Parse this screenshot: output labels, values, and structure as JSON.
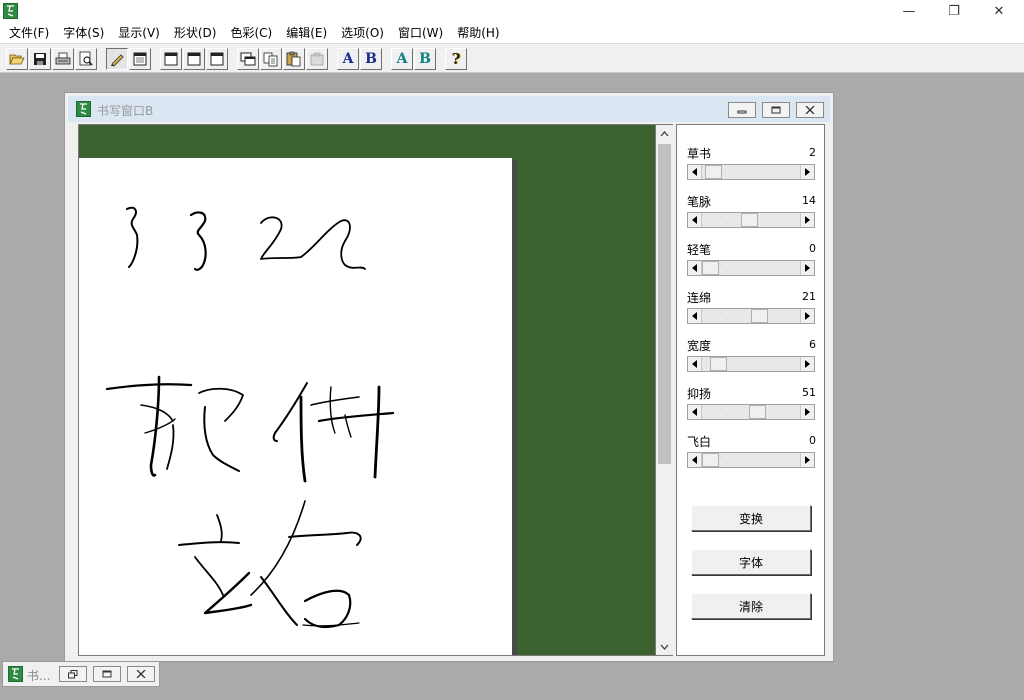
{
  "menu": [
    "文件(F)",
    "字体(S)",
    "显示(V)",
    "形状(D)",
    "色彩(C)",
    "编辑(E)",
    "选项(O)",
    "窗口(W)",
    "帮助(H)"
  ],
  "window_controls": {
    "minimize": "—",
    "restore": "❐",
    "close": "✕"
  },
  "toolbar": {
    "buttons": [
      "open-icon",
      "save-icon",
      "print-icon",
      "print-preview-icon",
      "pen-icon",
      "calendar-icon",
      "window-a-icon",
      "window-b-icon",
      "window-c-icon",
      "tile-icon",
      "copy-icon",
      "paste-icon",
      "disabled-icon",
      "font-a-icon",
      "font-b-icon",
      "style-a-icon",
      "style-b-icon",
      "help-icon"
    ],
    "letter_a": "A",
    "letter_b": "B",
    "help": "?"
  },
  "child_window": {
    "title": "书写窗口B"
  },
  "canvas": {
    "background_color": "#3b622f",
    "paper_color": "#ffffff"
  },
  "panel": {
    "sliders": [
      {
        "label": "草书",
        "value": "2",
        "level": 0.04
      },
      {
        "label": "笔脉",
        "value": "14",
        "level": 0.48
      },
      {
        "label": "轻笔",
        "value": "0",
        "level": 0.0
      },
      {
        "label": "连绵",
        "value": "21",
        "level": 0.6
      },
      {
        "label": "宽度",
        "value": "6",
        "level": 0.1
      },
      {
        "label": "抑扬",
        "value": "51",
        "level": 0.58
      },
      {
        "label": "飞白",
        "value": "0",
        "level": 0.0
      }
    ],
    "buttons": {
      "transform": "变换",
      "font": "字体",
      "clear": "清除"
    }
  },
  "minimized_window": {
    "title": "书..."
  }
}
